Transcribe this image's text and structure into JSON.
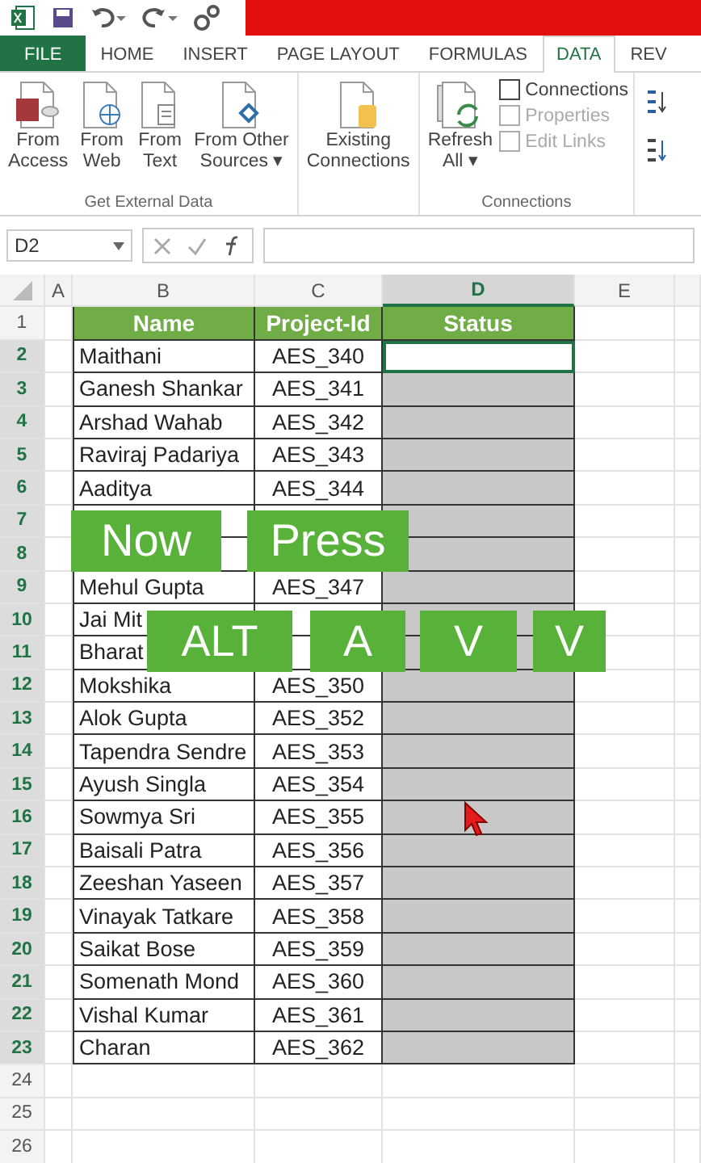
{
  "tabs": [
    {
      "label": "FILE",
      "kind": "file",
      "selected": false
    },
    {
      "label": "HOME",
      "kind": "tab",
      "selected": false
    },
    {
      "label": "INSERT",
      "kind": "tab",
      "selected": false
    },
    {
      "label": "PAGE LAYOUT",
      "kind": "tab",
      "selected": false
    },
    {
      "label": "FORMULAS",
      "kind": "tab",
      "selected": false
    },
    {
      "label": "DATA",
      "kind": "tab",
      "selected": true
    },
    {
      "label": "REV",
      "kind": "tab",
      "selected": false
    }
  ],
  "ribbon": {
    "groups": [
      {
        "label": "Get External Data",
        "buttons": [
          {
            "lines": [
              "From",
              "Access"
            ],
            "kind": "access"
          },
          {
            "lines": [
              "From",
              "Web"
            ],
            "kind": "web"
          },
          {
            "lines": [
              "From",
              "Text"
            ],
            "kind": "text"
          },
          {
            "lines": [
              "From Other",
              "Sources ▾"
            ],
            "kind": "other"
          }
        ]
      },
      {
        "buttons": [
          {
            "lines": [
              "Existing",
              "Connections"
            ],
            "kind": "existing"
          }
        ]
      },
      {
        "label": "Connections",
        "buttons": [
          {
            "lines": [
              "Refresh",
              "All ▾"
            ],
            "kind": "refresh"
          }
        ],
        "small_buttons": [
          {
            "label": "Connections",
            "disabled": false
          },
          {
            "label": "Properties",
            "disabled": true
          },
          {
            "label": "Edit Links",
            "disabled": true
          }
        ]
      }
    ]
  },
  "formula_bar": {
    "name_box": "D2"
  },
  "sheet": {
    "columns": [
      {
        "letter": "A",
        "selected": false
      },
      {
        "letter": "B",
        "selected": false
      },
      {
        "letter": "C",
        "selected": false
      },
      {
        "letter": "D",
        "selected": true
      },
      {
        "letter": "E",
        "selected": false
      }
    ],
    "header_row": {
      "number": "1",
      "cells": [
        "Name",
        "Project-Id",
        "Status"
      ]
    },
    "rows": [
      {
        "number": "2",
        "name": "Maithani",
        "project_id": "AES_340",
        "selected": true,
        "active": true
      },
      {
        "number": "3",
        "name": "Ganesh Shankar",
        "project_id": "AES_341",
        "selected": true,
        "active": false
      },
      {
        "number": "4",
        "name": "Arshad Wahab",
        "project_id": "AES_342",
        "selected": true,
        "active": false
      },
      {
        "number": "5",
        "name": "Raviraj Padariya",
        "project_id": "AES_343",
        "selected": true,
        "active": false
      },
      {
        "number": "6",
        "name": "Aaditya",
        "project_id": "AES_344",
        "selected": true,
        "active": false
      },
      {
        "number": "7",
        "selected": true,
        "active": false
      },
      {
        "number": "8",
        "selected": true,
        "active": false
      },
      {
        "number": "9",
        "name": "Mehul Gupta",
        "project_id": "AES_347",
        "selected": true,
        "active": false
      },
      {
        "number": "10",
        "name": "Jai Mit",
        "selected": true,
        "active": false
      },
      {
        "number": "11",
        "name": "Bharat",
        "selected": true,
        "active": false
      },
      {
        "number": "12",
        "name": "Mokshika",
        "project_id": "AES_350",
        "selected": true,
        "active": false
      },
      {
        "number": "13",
        "name": "Alok Gupta",
        "project_id": "AES_352",
        "selected": true,
        "active": false
      },
      {
        "number": "14",
        "name": "Tapendra Sendre",
        "project_id": "AES_353",
        "selected": true,
        "active": false
      },
      {
        "number": "15",
        "name": "Ayush Singla",
        "project_id": "AES_354",
        "selected": true,
        "active": false
      },
      {
        "number": "16",
        "name": "Sowmya Sri",
        "project_id": "AES_355",
        "selected": true,
        "active": false
      },
      {
        "number": "17",
        "name": "Baisali Patra",
        "project_id": "AES_356",
        "selected": true,
        "active": false
      },
      {
        "number": "18",
        "name": "Zeeshan Yaseen",
        "project_id": "AES_357",
        "selected": true,
        "active": false
      },
      {
        "number": "19",
        "name": "Vinayak Tatkare",
        "project_id": "AES_358",
        "selected": true,
        "active": false
      },
      {
        "number": "20",
        "name": "Saikat Bose",
        "project_id": "AES_359",
        "selected": true,
        "active": false
      },
      {
        "number": "21",
        "name": "Somenath Mond",
        "project_id": "AES_360",
        "selected": true,
        "active": false
      },
      {
        "number": "22",
        "name": "Vishal Kumar",
        "project_id": "AES_361",
        "selected": true,
        "active": false
      },
      {
        "number": "23",
        "name": "Charan",
        "project_id": "AES_362",
        "selected": true,
        "active": false
      }
    ],
    "empty_rows": [
      "24",
      "25",
      "26"
    ]
  },
  "captions": [
    {
      "text": "Now",
      "kind": "word"
    },
    {
      "text": "Press",
      "kind": "word"
    },
    {
      "text": "ALT",
      "kind": "key"
    },
    {
      "text": "A",
      "kind": "key"
    },
    {
      "text": "V",
      "kind": "key"
    },
    {
      "text": "V",
      "kind": "key"
    }
  ]
}
